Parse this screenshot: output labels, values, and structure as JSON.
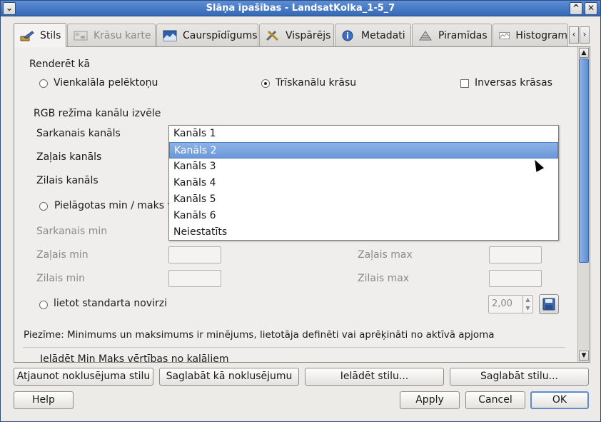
{
  "window": {
    "title": "Slāņa īpašības - LandsatKolka_1-5_7",
    "menu_glyph": "⌄",
    "maximize_glyph": "^",
    "close_glyph": "✕"
  },
  "tabs": [
    {
      "label": "Stils",
      "active": true
    },
    {
      "label": "Krāsu karte",
      "disabled": true
    },
    {
      "label": "Caurspīdīgums"
    },
    {
      "label": "Vispārējs"
    },
    {
      "label": "Metadati"
    },
    {
      "label": "Piramīdas"
    },
    {
      "label": "Histogram"
    }
  ],
  "tab_scroll": {
    "left": "‹",
    "right": "›"
  },
  "render": {
    "heading": "Renderēt kā",
    "option_gray": "Vienkalāla pelēktoņu",
    "option_rgb": "Trīskanālu krāsu",
    "invert": "Inversas krāsas"
  },
  "rgb": {
    "heading": "RGB režīma kanālu izvēle",
    "red_channel": "Sarkanais kanāls",
    "green_channel": "Zaļais kanāls",
    "blue_channel": "Zilais kanāls",
    "custom_minmax": "Pielāgotas min / maks vē",
    "red_min": "Sarkanais min",
    "green_min": "Zaļais min",
    "green_max": "Zaļais max",
    "blue_min": "Zilais min",
    "blue_max": "Zilais max",
    "stddev": "lietot standarta novirzi",
    "stddev_value": "2,00"
  },
  "note": "Piezīme: Minimums un maksimums ir minējums, lietotāja definēti vai aprēķināti no aktīvā apjoma",
  "load_minmax_partial": "Ielādēt Min Maks vērtības no kaļāliem",
  "dropdown": {
    "items": [
      "Kanāls 1",
      "Kanāls 2",
      "Kanāls 3",
      "Kanāls 4",
      "Kanāls 5",
      "Kanāls 6",
      "Neiestatīts"
    ],
    "selected_index": 1
  },
  "buttons": {
    "restore_default": "Atjaunot noklusējuma stilu",
    "save_default": "Saglabāt kā noklusējumu",
    "load_style": "Ielādēt stilu...",
    "save_style": "Saglabāt stilu...",
    "help": "Help",
    "apply": "Apply",
    "cancel": "Cancel",
    "ok": "OK"
  }
}
